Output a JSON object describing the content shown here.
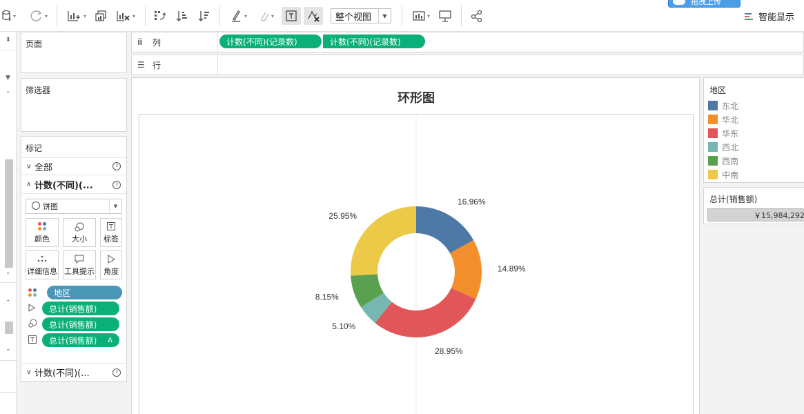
{
  "toolbar": {
    "view_mode": "整个视图",
    "smart_show": "智能显示",
    "upload_tab": "拖拽上传",
    "colors": {
      "accent_green": "#0aaf79"
    }
  },
  "shelves": {
    "pages": {
      "label": "页面"
    },
    "columns": {
      "label": "列",
      "pills": [
        "计数(不同)(记录数)",
        "计数(不同)(记录数)"
      ]
    },
    "rows": {
      "label": "行"
    }
  },
  "filters": {
    "label": "筛选器"
  },
  "marks": {
    "label": "标记",
    "all": "全部",
    "active_section": "计数(不同)(...",
    "mark_type": "饼图",
    "buttons": {
      "color": "颜色",
      "size": "大小",
      "label": "标签",
      "detail": "详细信息",
      "tooltip": "工具提示",
      "angle": "角度"
    },
    "fields": [
      {
        "icon": "color-dots-icon",
        "label": "地区",
        "color": "#4a97b5"
      },
      {
        "icon": "angle-icon",
        "label": "总计(销售额)",
        "color": "#0aaf79"
      },
      {
        "icon": "size-icon",
        "label": "总计(销售额)",
        "color": "#0aaf79"
      },
      {
        "icon": "label-icon",
        "label": "总计(销售额)",
        "color": "#0aaf79",
        "delta": "Δ"
      }
    ],
    "second_section": "计数(不同)(..."
  },
  "viz": {
    "title": "环形图"
  },
  "legend": {
    "title": "地区",
    "items": [
      {
        "label": "东北",
        "color": "#4e79a7"
      },
      {
        "label": "华北",
        "color": "#f28e2b"
      },
      {
        "label": "华东",
        "color": "#e15759"
      },
      {
        "label": "西北",
        "color": "#76b7b2"
      },
      {
        "label": "西南",
        "color": "#59a14f"
      },
      {
        "label": "中南",
        "color": "#edc948"
      }
    ]
  },
  "total": {
    "title": "总计(销售额)",
    "value": "￥15,984,292"
  },
  "chart_data": {
    "type": "pie",
    "title": "环形图",
    "donut": true,
    "legend_position": "right",
    "categories": [
      "东北",
      "华北",
      "华东",
      "西北",
      "西南",
      "中南"
    ],
    "values": [
      16.96,
      14.89,
      28.95,
      5.1,
      8.15,
      25.95
    ],
    "labels": [
      "16.96%",
      "14.89%",
      "28.95%",
      "5.10%",
      "8.15%",
      "25.95%"
    ],
    "colors": [
      "#4e79a7",
      "#f28e2b",
      "#e15759",
      "#76b7b2",
      "#59a14f",
      "#edc948"
    ]
  }
}
